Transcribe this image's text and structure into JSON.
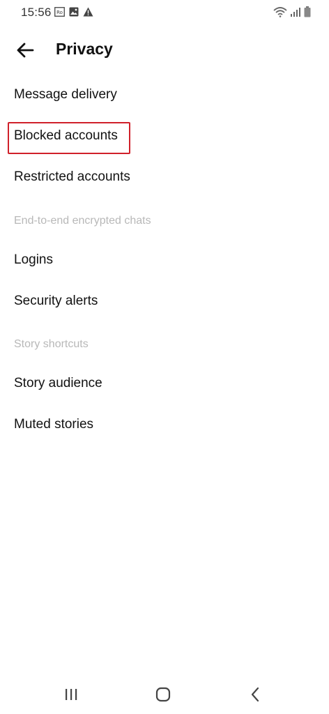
{
  "status_bar": {
    "time": "15:56",
    "left_icons": [
      "ro-badge-icon",
      "image-icon",
      "warning-icon"
    ],
    "right_icons": [
      "wifi-icon",
      "signal-icon",
      "battery-icon"
    ]
  },
  "header": {
    "title": "Privacy",
    "back_icon": "back-arrow-icon"
  },
  "items": {
    "message_delivery": "Message delivery",
    "blocked_accounts": "Blocked accounts",
    "restricted_accounts": "Restricted accounts",
    "section_e2e": "End-to-end encrypted chats",
    "logins": "Logins",
    "security_alerts": "Security alerts",
    "section_story": "Story shortcuts",
    "story_audience": "Story audience",
    "muted_stories": "Muted stories"
  },
  "highlight": {
    "target": "blocked_accounts",
    "color": "#d0202a"
  },
  "nav_bar": {
    "icons": [
      "recent-apps-icon",
      "home-icon",
      "back-nav-icon"
    ]
  }
}
